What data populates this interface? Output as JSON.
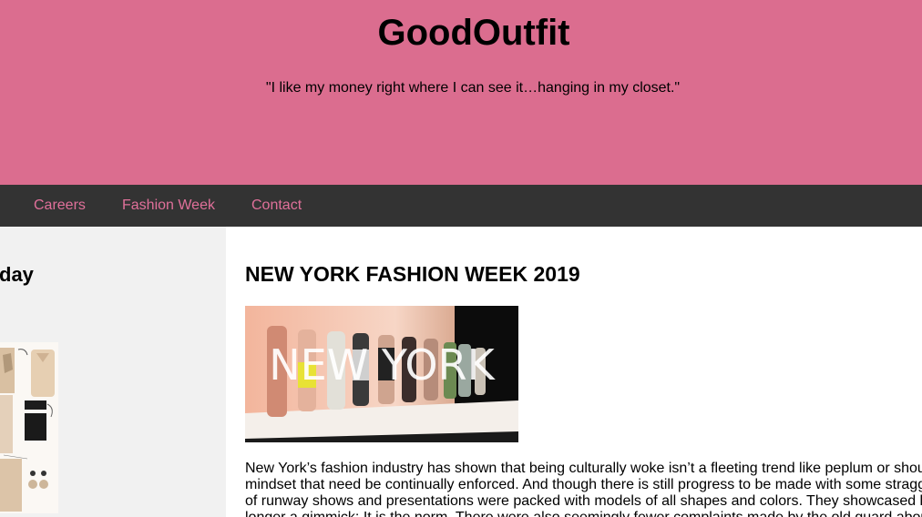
{
  "header": {
    "site_title": "GoodOutfit",
    "tagline": "\"I like my money right where I can see it…hanging in my closet.\""
  },
  "nav": {
    "items": [
      {
        "label": "Careers"
      },
      {
        "label": "Fashion Week"
      },
      {
        "label": "Contact"
      }
    ]
  },
  "sidebar": {
    "heading": "day"
  },
  "post": {
    "title": "NEW YORK FASHION WEEK 2019",
    "image_overlay_text": "NEW YORK",
    "lines": [
      "New York’s fashion industry has shown that being culturally woke isn’t a fleeting trend like peplum or shou",
      "mindset that need be continually enforced. And though there is still progress to be made with some stragg",
      "of runway shows and presentations were packed with models of all shapes and colors. They showcased l",
      "longer a gimmick: It is the norm. There were also seemingly fewer complaints made by the old guard abou"
    ]
  },
  "colors": {
    "header_bg": "#db6d8f",
    "nav_bg": "#333333",
    "nav_link": "#e0709a",
    "sidebar_bg": "#f1f1f1"
  }
}
